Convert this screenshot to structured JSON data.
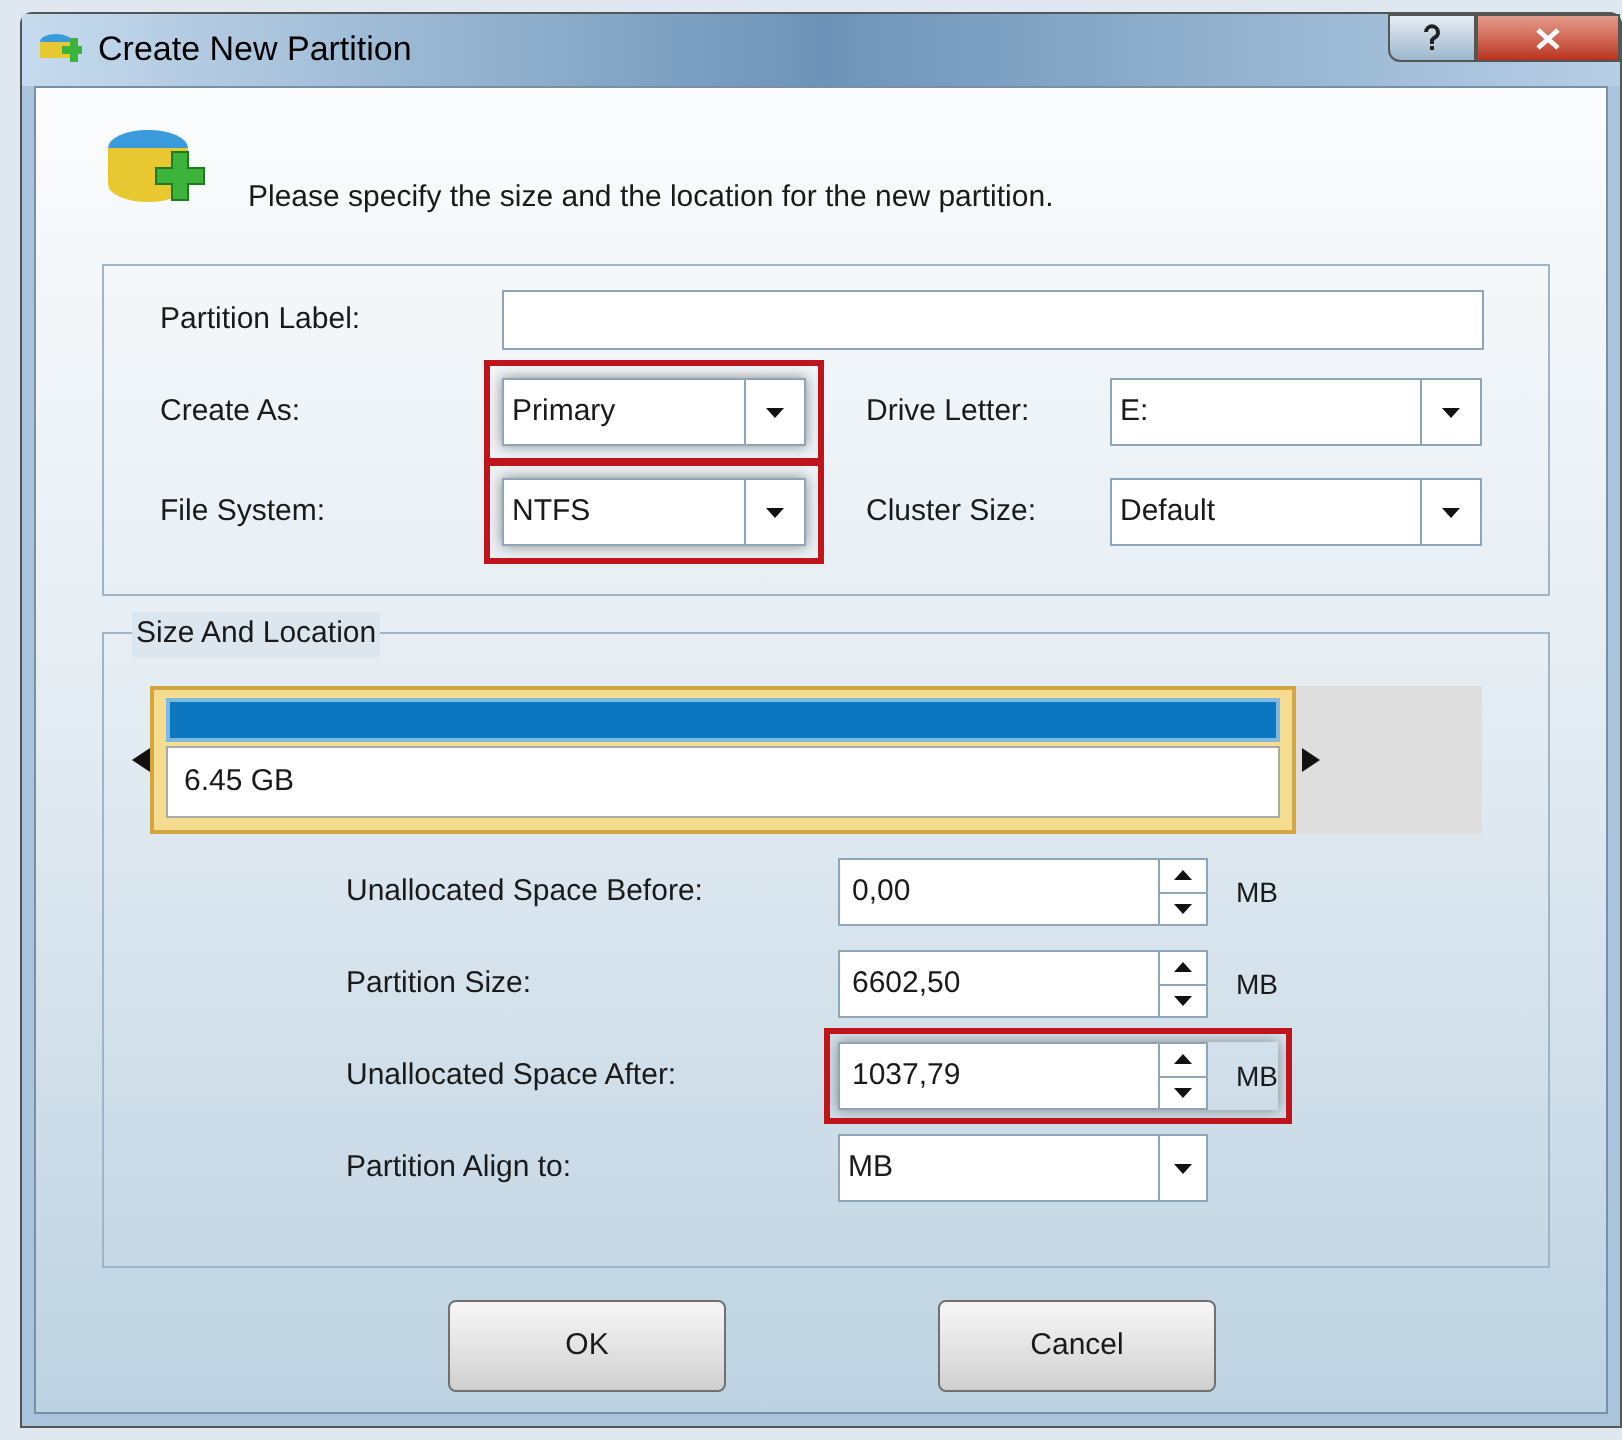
{
  "window": {
    "title": "Create New Partition"
  },
  "header": {
    "text": "Please specify the size and the location for the new partition."
  },
  "partition_label": {
    "label": "Partition Label:"
  },
  "combos": [
    {
      "label": "Create As:",
      "value": "Primary",
      "highlighted": true
    },
    {
      "label": "Drive Letter:",
      "value": "E:",
      "highlighted": false
    },
    {
      "label": "File System:",
      "value": "NTFS",
      "highlighted": true
    },
    {
      "label": "Cluster Size:",
      "value": "Default",
      "highlighted": false
    }
  ],
  "size_and_location": {
    "title": "Size And Location",
    "partition": {
      "size": "6.45 GB",
      "level": 0.86
    },
    "rows": [
      {
        "kind": "spin",
        "label": "Unallocated Space Before:",
        "value": "0,00",
        "unit": "MB",
        "highlighted": false
      },
      {
        "kind": "spin",
        "label": "Partition Size:",
        "value": "6602,50",
        "unit": "MB",
        "highlighted": false
      },
      {
        "kind": "spin",
        "label": "Unallocated Space After:",
        "value": "1037,79",
        "unit": "MB",
        "highlighted": true
      },
      {
        "kind": "combo",
        "label": "Partition Align to:",
        "value": "MB",
        "highlighted": false
      }
    ]
  },
  "buttons": [
    "OK",
    "Cancel"
  ]
}
